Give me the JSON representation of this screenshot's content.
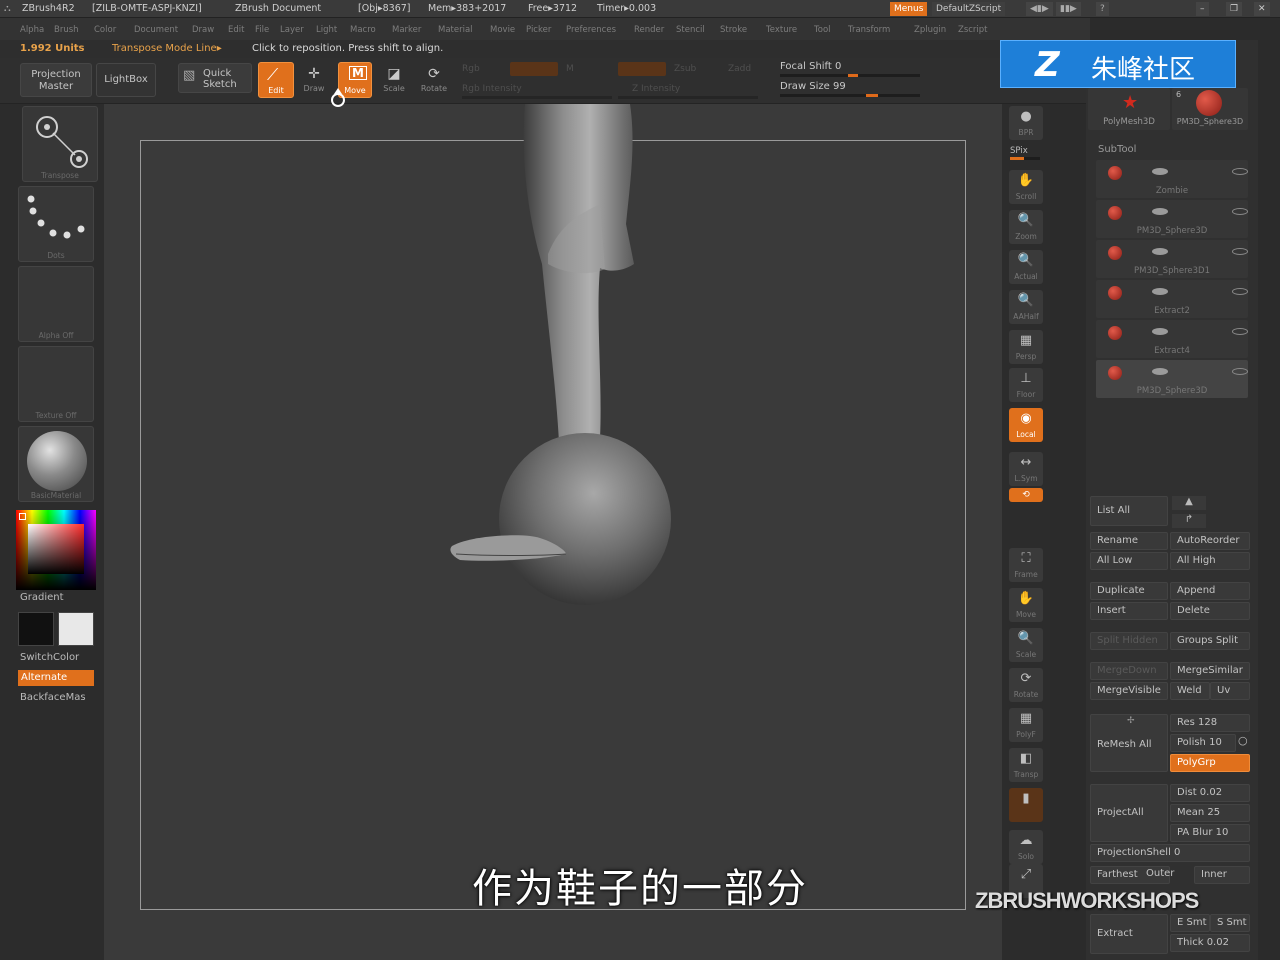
{
  "titlebar": {
    "app": "ZBrush4R2",
    "serial": "[ZILB-OMTE-ASPJ-KNZI]",
    "document": "ZBrush Document",
    "obj": "[Obj▸8367]",
    "mem": "Mem▸383+2017",
    "free": "Free▸3712",
    "timer": "Timer▸0.003",
    "menus_btn": "Menus",
    "script_btn": "DefaultZScript"
  },
  "menubar": [
    "Alpha",
    "Brush",
    "Color",
    "Document",
    "Draw",
    "Edit",
    "File",
    "Layer",
    "Light",
    "Macro",
    "Marker",
    "Material",
    "Movie",
    "Picker",
    "Preferences",
    "Render",
    "Stencil",
    "Stroke",
    "Texture",
    "Tool",
    "Transform",
    "Zplugin",
    "Zscript"
  ],
  "infoline": {
    "units": "1.992 Units",
    "mode": "Transpose Mode Line▸",
    "hint": "Click to reposition. Press shift to align."
  },
  "toolbar": {
    "projection_master": "Projection Master",
    "lightbox": "LightBox",
    "quick_sketch": "Quick Sketch",
    "edit": "Edit",
    "draw": "Draw",
    "move": "Move",
    "scale": "Scale",
    "rotate": "Rotate",
    "rgb": "Rgb",
    "mrgb": "M",
    "zadd": "Zadd",
    "zsub": "Zsub",
    "rgb_intensity": "Rgb Intensity",
    "z_intensity": "Z Intensity",
    "focal_shift": "Focal Shift 0",
    "draw_size": "Draw Size 99"
  },
  "leftshelf": {
    "transpose": "Transpose",
    "dots": "Dots",
    "alpha_off": "Alpha Off",
    "texture_off": "Texture Off",
    "basic_material": "BasicMaterial",
    "gradient": "Gradient",
    "switch_color": "SwitchColor",
    "alternate": "Alternate",
    "backface": "BackfaceMas"
  },
  "rightshelf": [
    {
      "name": "bpr",
      "label": "BPR",
      "glyph": "●"
    },
    {
      "name": "scroll",
      "label": "Scroll",
      "glyph": "✋"
    },
    {
      "name": "zoom",
      "label": "Zoom",
      "glyph": "🔍"
    },
    {
      "name": "actual",
      "label": "Actual",
      "glyph": "🔍"
    },
    {
      "name": "aahalf",
      "label": "AAHalf",
      "glyph": "🔍"
    },
    {
      "name": "persp",
      "label": "Persp",
      "glyph": "▦"
    },
    {
      "name": "floor",
      "label": "Floor",
      "glyph": "⊥"
    },
    {
      "name": "local",
      "label": "Local",
      "glyph": "◉"
    },
    {
      "name": "lsym",
      "label": "L.Sym",
      "glyph": "↔"
    },
    {
      "name": "xyz",
      "label": "Xyz",
      "glyph": "⟲"
    },
    {
      "name": "frame",
      "label": "Frame",
      "glyph": "⛶"
    },
    {
      "name": "move",
      "label": "Move",
      "glyph": "✋"
    },
    {
      "name": "scale",
      "label": "Scale",
      "glyph": "🔍"
    },
    {
      "name": "rotate",
      "label": "Rotate",
      "glyph": "⟳"
    },
    {
      "name": "polyf",
      "label": "PolyF",
      "glyph": "▦"
    },
    {
      "name": "transp",
      "label": "Transp",
      "glyph": "◧"
    },
    {
      "name": "ghost",
      "label": "",
      "glyph": "▮"
    },
    {
      "name": "solo",
      "label": "Solo",
      "glyph": "☁"
    },
    {
      "name": "xpose",
      "label": "",
      "glyph": "⤢"
    }
  ],
  "rightshelf_extra": {
    "spix": "SPix"
  },
  "palette": {
    "polymesh": "PolyMesh3D",
    "pm3d_sphere": "PM3D_Sphere3D",
    "pm3d_count": "6",
    "subtool_title": "SubTool",
    "subtools": [
      "Zombie",
      "PM3D_Sphere3D",
      "PM3D_Sphere3D1",
      "Extract2",
      "Extract4",
      "PM3D_Sphere3D"
    ],
    "list_all": "List All",
    "rename": "Rename",
    "auto_reorder": "AutoReorder",
    "all_low": "All Low",
    "all_high": "All High",
    "duplicate": "Duplicate",
    "append": "Append",
    "insert": "Insert",
    "delete": "Delete",
    "split_hidden": "Split Hidden",
    "groups_split": "Groups Split",
    "merge_down": "MergeDown",
    "merge_similar": "MergeSimilar",
    "merge_visible": "MergeVisible",
    "weld": "Weld",
    "uv": "Uv",
    "remesh_all": "ReMesh All",
    "res": "Res 128",
    "polish": "Polish 10",
    "polygrp": "PolyGrp",
    "project_all": "ProjectAll",
    "dist": "Dist 0.02",
    "mean": "Mean 25",
    "pa_blur": "PA Blur 10",
    "projection_shell": "ProjectionShell 0",
    "farthest": "Farthest",
    "outer": "Outer",
    "inner": "Inner",
    "extract": "Extract",
    "e_smt": "E Smt",
    "s_smt": "S Smt",
    "thick": "Thick 0.02"
  },
  "overlay": {
    "badge": "朱峰社区",
    "subtitle": "作为鞋子的一部分",
    "watermark": "ZBRUSHWORKSHOPS"
  },
  "colors": {
    "accent": "#e0701c",
    "primary_color": "#ff2a2a",
    "badge_bg": "#1e7fd8"
  }
}
